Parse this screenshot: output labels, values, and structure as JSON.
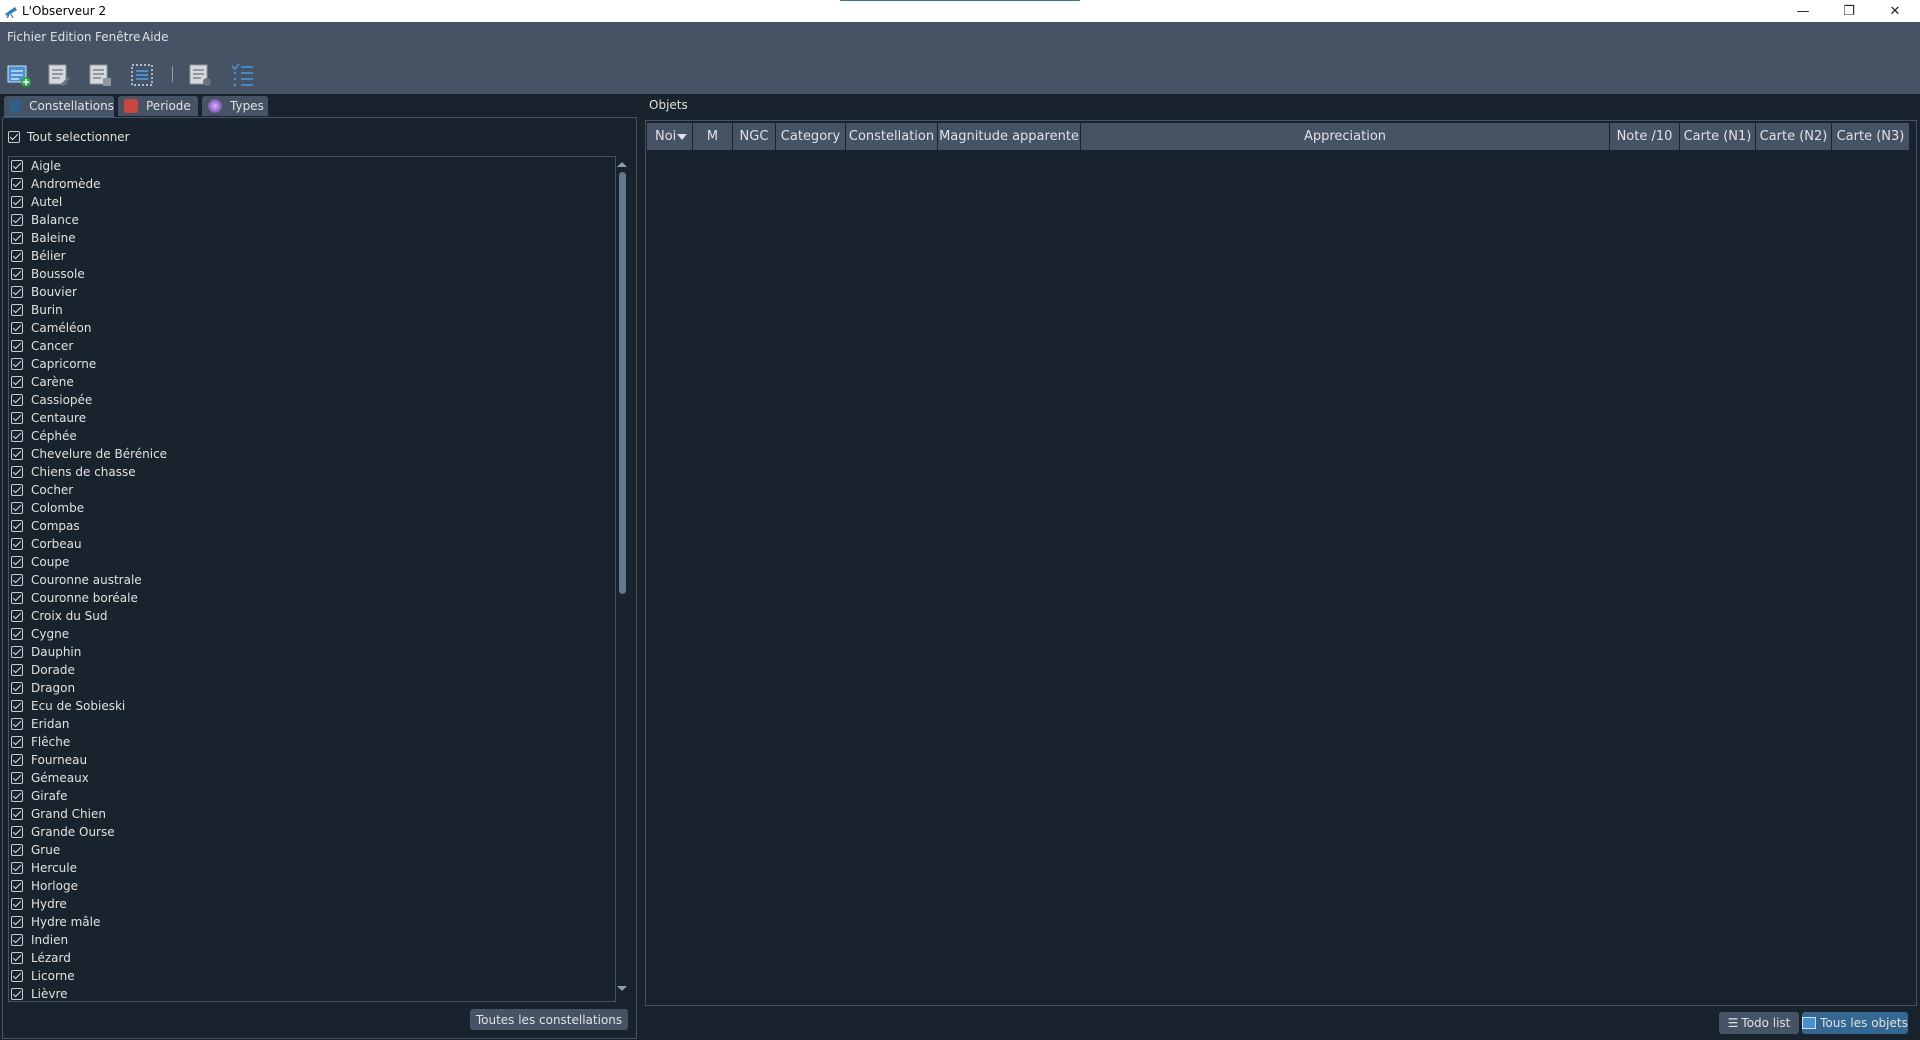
{
  "window": {
    "title": "L'Observeur 2",
    "controls": {
      "minimize": "—",
      "restore": "❐",
      "close": "✕"
    }
  },
  "menubar": [
    "Fichier",
    "Edition",
    "Fenêtre",
    "Aide"
  ],
  "toolbar": {
    "icons": [
      "new-observation-icon",
      "edit-observation-icon",
      "delete-observation-icon",
      "select-all-icon",
      "export-icon",
      "list-view-icon"
    ]
  },
  "tabs": [
    {
      "label": "Constellations",
      "icon": "constellation-icon",
      "active": true
    },
    {
      "label": "Periode",
      "icon": "calendar-icon",
      "active": false
    },
    {
      "label": "Types",
      "icon": "galaxy-icon",
      "active": false
    }
  ],
  "left": {
    "select_all_label": "Tout selectionner",
    "constellations": [
      "Aigle",
      "Andromède",
      "Autel",
      "Balance",
      "Baleine",
      "Bélier",
      "Boussole",
      "Bouvier",
      "Burin",
      "Caméléon",
      "Cancer",
      "Capricorne",
      "Carène",
      "Cassiopée",
      "Centaure",
      "Céphée",
      "Chevelure de Bérénice",
      "Chiens de chasse",
      "Cocher",
      "Colombe",
      "Compas",
      "Corbeau",
      "Coupe",
      "Couronne australe",
      "Couronne boréale",
      "Croix du Sud",
      "Cygne",
      "Dauphin",
      "Dorade",
      "Dragon",
      "Ecu de Sobieski",
      "Eridan",
      "Flêche",
      "Fourneau",
      "Gémeaux",
      "Girafe",
      "Grand Chien",
      "Grande Ourse",
      "Grue",
      "Hercule",
      "Horloge",
      "Hydre",
      "Hydre mâle",
      "Indien",
      "Lézard",
      "Licorne",
      "Lièvre"
    ],
    "all_constellations_button": "Toutes les constellations"
  },
  "right": {
    "label": "Objets",
    "columns": [
      "Nom",
      "M",
      "NGC",
      "Category",
      "Constellation",
      "Magnitude apparente",
      "Appreciation",
      "Note /10",
      "Carte (N1)",
      "Carte (N2)",
      "Carte (N3)"
    ],
    "visible_first_column": "Noi"
  },
  "bottom_buttons": {
    "todo": "Todo list",
    "all_objects": "Tous les objets"
  },
  "colors": {
    "background": "#19232d",
    "panel": "#455364",
    "accent": "#346792",
    "text": "#e0e1e3"
  }
}
